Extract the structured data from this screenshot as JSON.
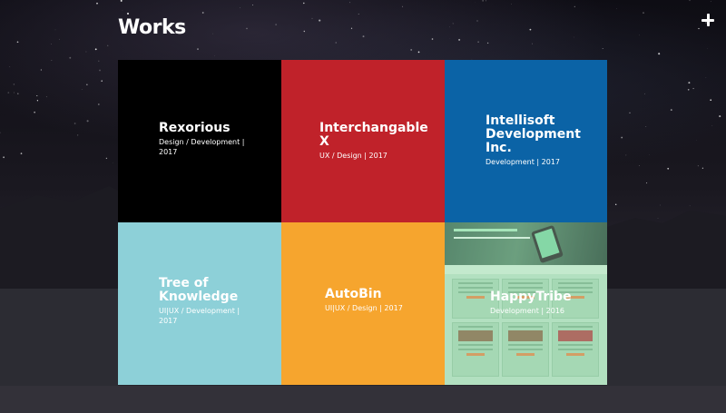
{
  "header": {
    "title": "Works",
    "add_icon": "plus-icon"
  },
  "tiles": [
    {
      "name": "Rexorious",
      "tags": "Design / Development | 2017",
      "color": "#000000"
    },
    {
      "name": "Interchangable X",
      "tags": "UX / Design | 2017",
      "color": "#c0222a"
    },
    {
      "name": "Intellisoft Development Inc.",
      "tags": "Development | 2017",
      "color": "#0b63a6"
    },
    {
      "name": "Tree of Knowledge",
      "tags": "UI|UX / Development | 2017",
      "color": "#8dd0d8"
    },
    {
      "name": "AutoBin",
      "tags": "UI|UX / Design | 2017",
      "color": "#f6a52e"
    },
    {
      "name": "HappyTribe",
      "tags": "Development | 2016",
      "color": "#b9e2c4"
    }
  ]
}
